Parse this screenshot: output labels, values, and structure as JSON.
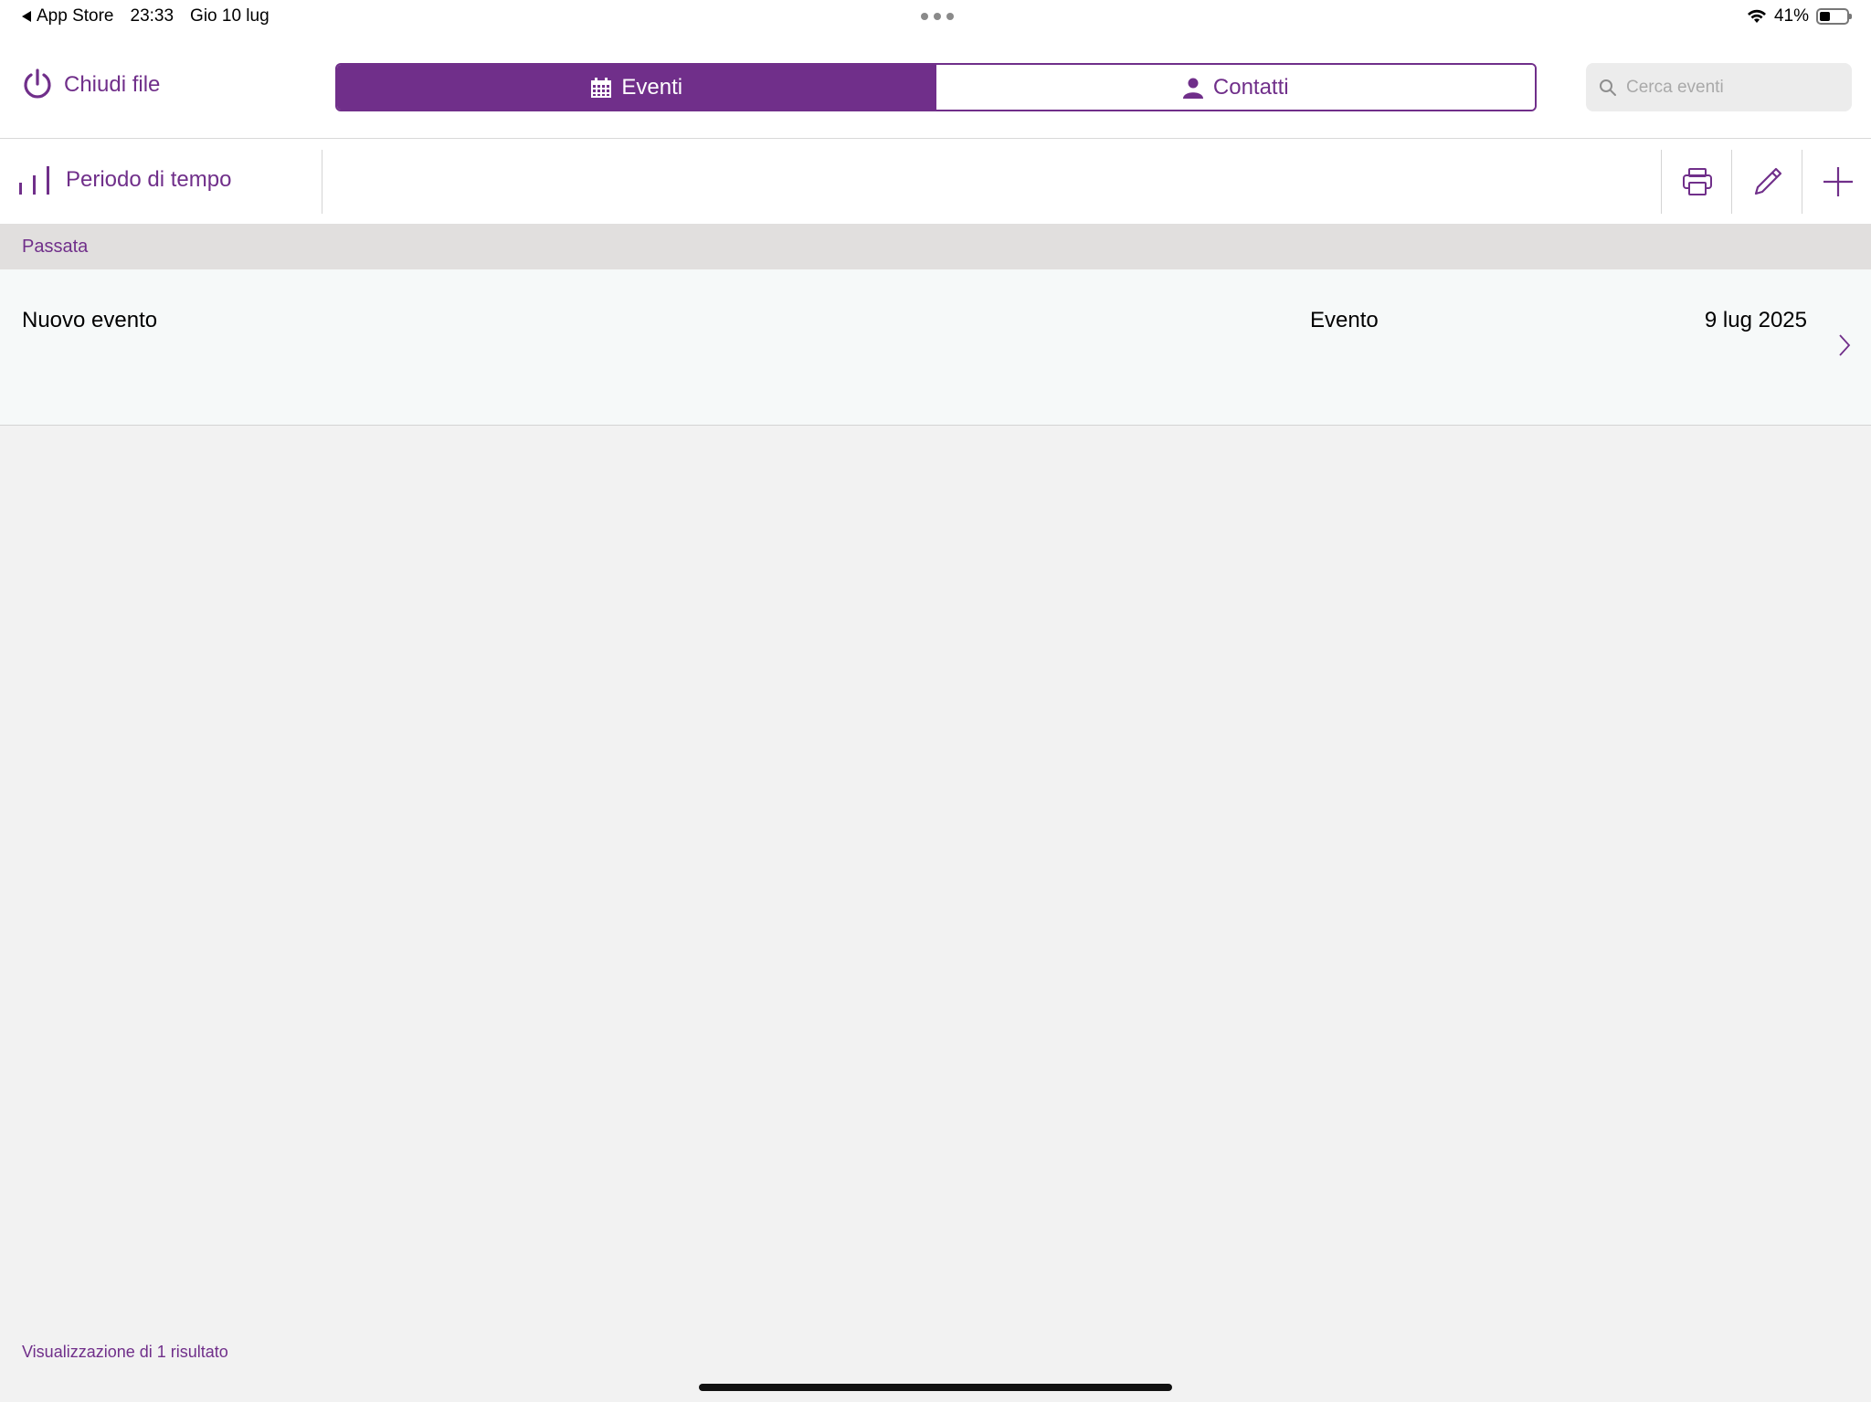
{
  "status_bar": {
    "back_app": "App Store",
    "time": "23:33",
    "date": "Gio 10 lug",
    "battery": "41%",
    "battery_level": 0.41
  },
  "header": {
    "close_file_label": "Chiudi file",
    "tabs": [
      {
        "label": "Eventi",
        "icon": "calendar-icon",
        "active": true
      },
      {
        "label": "Contatti",
        "icon": "person-icon",
        "active": false
      }
    ],
    "search": {
      "placeholder": "Cerca eventi",
      "value": ""
    }
  },
  "toolbar": {
    "time_period_label": "Periodo di tempo",
    "actions": [
      "print-icon",
      "pencil-icon",
      "plus-icon"
    ]
  },
  "list": {
    "section_title": "Passata",
    "rows": [
      {
        "name": "Nuovo evento",
        "type": "Evento",
        "date": "9 lug 2025"
      }
    ]
  },
  "footer": {
    "results_text": "Visualizzazione di 1 risultato"
  },
  "colors": {
    "accent": "#702f8a",
    "section_bg": "#e1dfde",
    "background": "#f2f2f2"
  }
}
